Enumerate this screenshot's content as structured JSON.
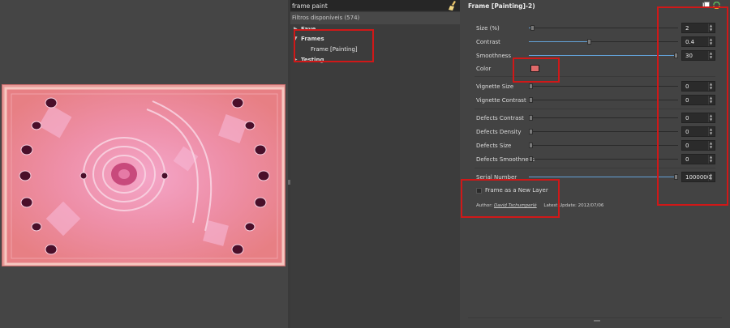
{
  "search": {
    "value": "frame paint"
  },
  "filter_list": {
    "available_label": "Filtros disponíveis (574)",
    "tree": [
      {
        "label": "Fave",
        "expanded": false
      },
      {
        "label": "Frames",
        "expanded": true,
        "children": [
          "Frame [Painting]"
        ]
      },
      {
        "label": "Testing",
        "expanded": false
      }
    ]
  },
  "params": {
    "title": "Frame [Painting]-2)",
    "rows": [
      {
        "label": "Size (%)",
        "value": "2",
        "level": 0.02
      },
      {
        "label": "Contrast",
        "value": "0.4",
        "level": 0.4
      },
      {
        "label": "Smoothness",
        "value": "30",
        "level": 1.0
      },
      {
        "label": "Color"
      },
      {
        "label": "Vignette Size",
        "value": "0",
        "level": 0
      },
      {
        "label": "Vignette Contrast",
        "value": "0",
        "level": 0
      },
      {
        "label": "Defects Contrast",
        "value": "0",
        "level": 0
      },
      {
        "label": "Defects Density",
        "value": "0",
        "level": 0
      },
      {
        "label": "Defects Size",
        "value": "0",
        "level": 0
      },
      {
        "label": "Defects Smoothness",
        "value": "0",
        "level": 0
      },
      {
        "label": "Serial Number",
        "value": "1000000",
        "level": 1.0
      }
    ],
    "color_value": "#e06a6a",
    "new_layer_label": "Frame as a New Layer",
    "author_prefix": "Author:",
    "author_name": "David Tschumperlé",
    "updated": "Latest Update: 2012/07/06"
  },
  "colors": {
    "accent": "#63a2d8",
    "highlight": "#d01818"
  }
}
